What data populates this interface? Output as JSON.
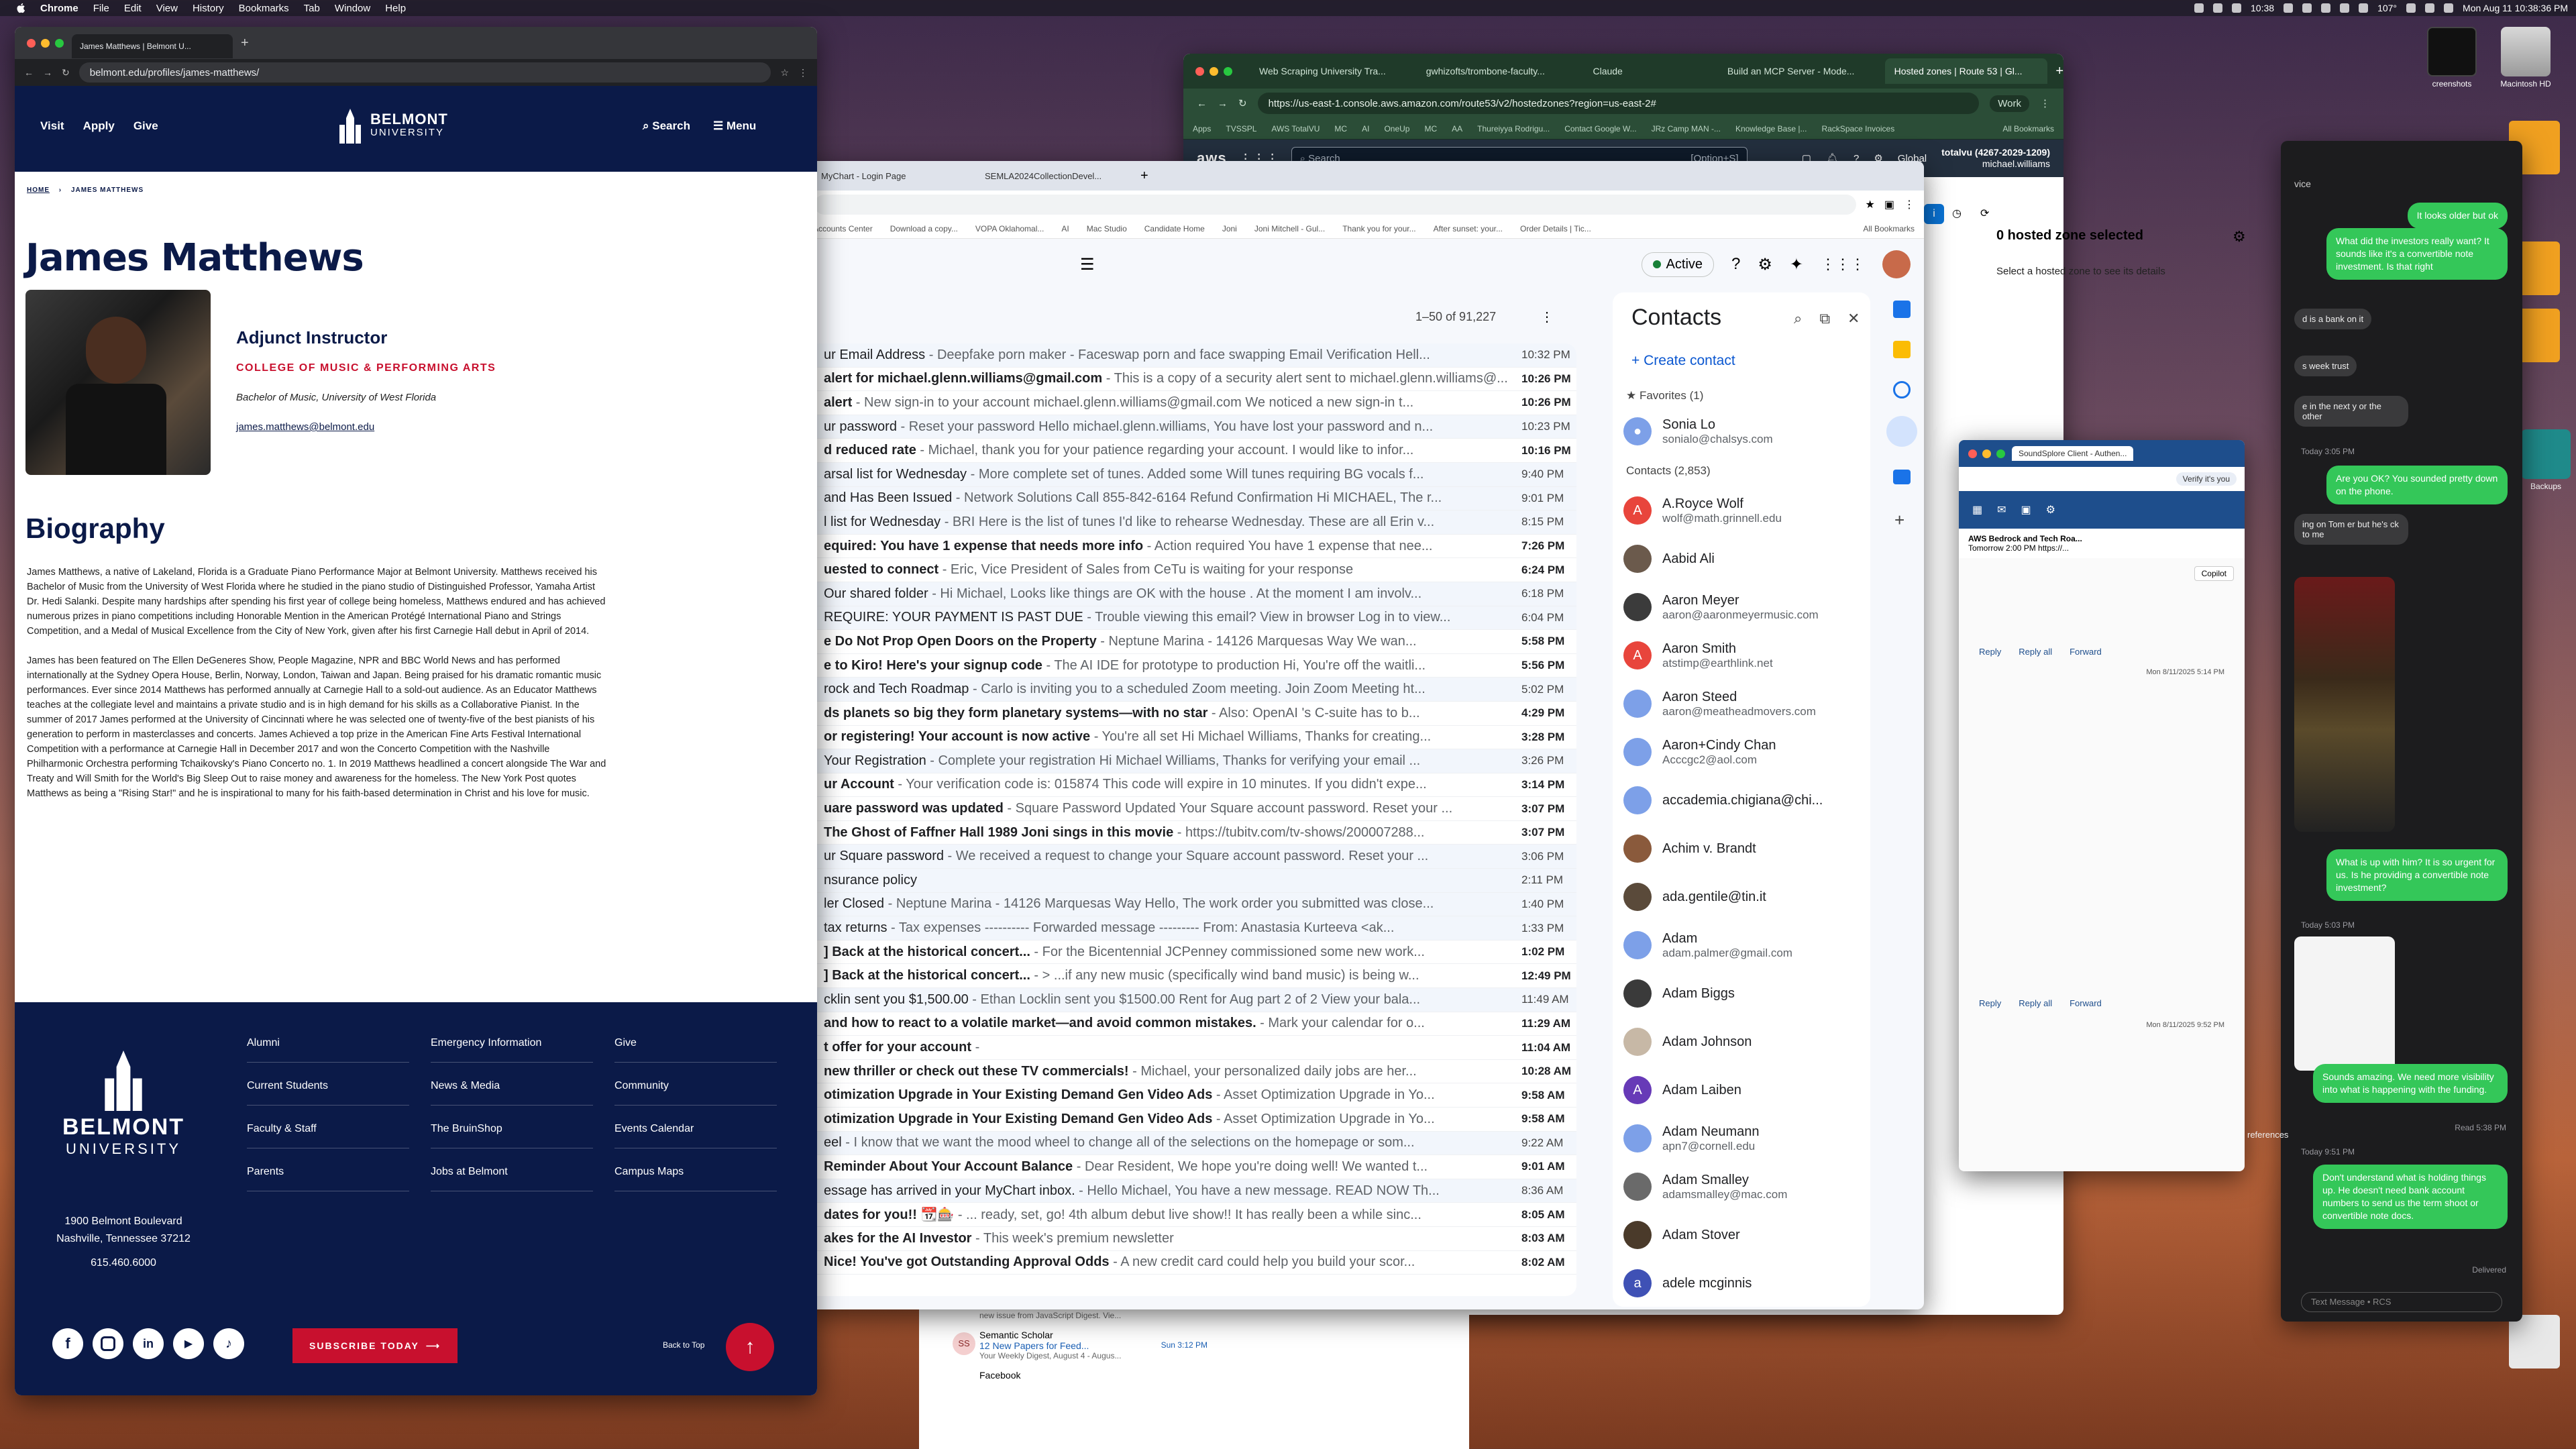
{
  "menubar": {
    "app": "Chrome",
    "items": [
      "File",
      "Edit",
      "View",
      "History",
      "Bookmarks",
      "Tab",
      "Window",
      "Help"
    ],
    "time_small": "10:38",
    "weather": "107°",
    "datetime": "Mon Aug 11  10:38:36 PM"
  },
  "desktop": {
    "icons": [
      "Macintosh HD",
      "creenshots",
      "Backups"
    ]
  },
  "aws": {
    "tabs": [
      "Web Scraping University Tra...",
      "gwhizofts/trombone-faculty...",
      "Claude",
      "Build an MCP Server - Mode...",
      "Hosted zones | Route 53 | Gl..."
    ],
    "url": "https://us-east-1.console.aws.amazon.com/route53/v2/hostedzones?region=us-east-2#",
    "profile": "Work",
    "bookmarks": [
      "Apps",
      "TVSSPL",
      "AWS TotalVU",
      "MC",
      "AI",
      "OneUp",
      "MC",
      "AA",
      "Thureiyya Rodrigu...",
      "Contact Google W...",
      "JRz Camp MAN -...",
      "Knowledge Base |...",
      "RackSpace Invoices",
      "All Bookmarks"
    ],
    "search_placeholder": "Search",
    "search_shortcut": "[Option+S]",
    "region": "Global",
    "account": "totalvu (4267-2029-1209)",
    "user": "michael.williams",
    "panel_title": "0 hosted zone selected",
    "panel_text": "Select a hosted zone to see its details"
  },
  "messages": {
    "items": [
      {
        "type": "out",
        "text": "It looks older but ok"
      },
      {
        "type": "out",
        "text": "What did the investors really want? It sounds like it's a convertible note investment. Is that right"
      },
      {
        "type": "in",
        "text": "d is a bank on it"
      },
      {
        "type": "in",
        "text": "s week trust"
      },
      {
        "type": "in",
        "text": "e in the next y or the other"
      },
      {
        "type": "time",
        "text": "Today 3:05 PM"
      },
      {
        "type": "out",
        "text": "Are you OK? You sounded pretty down on the phone."
      },
      {
        "type": "in",
        "text": "ing on Tom er but he's ck to me"
      },
      {
        "type": "out",
        "text": "What is up with him? It is so urgent for us. Is he providing a convertible note investment?"
      },
      {
        "type": "time",
        "text": "Today 5:03 PM"
      },
      {
        "type": "out",
        "text": "Sounds amazing. We need more visibility into what is happening with the funding."
      },
      {
        "type": "read",
        "text": "Read 5:38 PM"
      },
      {
        "type": "time",
        "text": "Today 9:51 PM"
      },
      {
        "type": "out",
        "text": "Don't understand what is holding things up. He doesn't need bank account numbers to send us the term shoot or convertible note docs."
      },
      {
        "type": "read",
        "text": "Delivered"
      }
    ],
    "input_placeholder": "Text Message • RCS"
  },
  "gmail": {
    "tabs": [
      "MyChart - Login Page",
      "SEMLA2024CollectionDevel..."
    ],
    "bookmarks": [
      "Accounts Center",
      "Download a copy...",
      "VOPA Oklahomal...",
      "AI",
      "Mac Studio",
      "Candidate Home",
      "Joni",
      "Joni Mitchell - Gul...",
      "Thank you for your...",
      "After sunset: your...",
      "Order Details | Tic...",
      "All Bookmarks"
    ],
    "status": "Active",
    "range": "1–50 of 91,227",
    "emails": [
      {
        "subject": "ur Email Address",
        "snippet": " - Deepfake porn maker - Faceswap porn and face swapping Email Verification Hell...",
        "time": "10:32 PM",
        "unread": false
      },
      {
        "subject": "alert for michael.glenn.williams@gmail.com",
        "snippet": " - This is a copy of a security alert sent to michael.glenn.williams@...",
        "time": "10:26 PM",
        "unread": true
      },
      {
        "subject": "alert",
        "snippet": " - New sign-in to your account michael.glenn.williams@gmail.com We noticed a new sign-in t...",
        "time": "10:26 PM",
        "unread": true
      },
      {
        "subject": "ur password",
        "snippet": " - Reset your password Hello michael.glenn.williams, You have lost your password and n...",
        "time": "10:23 PM",
        "unread": false
      },
      {
        "subject": "d reduced rate",
        "snippet": " - Michael, thank you for your patience regarding your account. I would like to infor...",
        "time": "10:16 PM",
        "unread": true
      },
      {
        "subject": "arsal list for Wednesday",
        "snippet": " - More complete set of tunes. Added some Will tunes requiring BG vocals f...",
        "time": "9:40 PM",
        "unread": false
      },
      {
        "subject": "and Has Been Issued",
        "snippet": " - Network Solutions Call 855-842-6164 Refund Confirmation Hi MICHAEL, The r...",
        "time": "9:01 PM",
        "unread": false
      },
      {
        "subject": "l list for Wednesday",
        "snippet": " - BRI Here is the list of tunes I'd like to rehearse Wednesday. These are all Erin v...",
        "time": "8:15 PM",
        "unread": false
      },
      {
        "subject": "equired: You have 1 expense that needs more info",
        "snippet": " - Action required You have 1 expense that nee...",
        "time": "7:26 PM",
        "unread": true
      },
      {
        "subject": "uested to connect",
        "snippet": " - Eric, Vice President of Sales from CeTu is waiting for your response",
        "time": "6:24 PM",
        "unread": true
      },
      {
        "subject": " Our shared folder",
        "snippet": " - Hi Michael, Looks like things are OK with the house . At the moment I am involv...",
        "time": "6:18 PM",
        "unread": false
      },
      {
        "subject": "REQUIRE: YOUR PAYMENT IS PAST DUE",
        "snippet": " - Trouble viewing this email? View in browser Log in to view...",
        "time": "6:04 PM",
        "unread": false
      },
      {
        "subject": "e Do Not Prop Open Doors on the Property",
        "snippet": " - Neptune Marina - 14126 Marquesas Way We wan...",
        "time": "5:58 PM",
        "unread": true
      },
      {
        "subject": "e to Kiro! Here's your signup code",
        "snippet": " - The AI IDE for prototype to production Hi, You're off the waitli...",
        "time": "5:56 PM",
        "unread": true
      },
      {
        "subject": "rock and Tech Roadmap",
        "snippet": " - Carlo is inviting you to a scheduled Zoom meeting. Join Zoom Meeting ht...",
        "time": "5:02 PM",
        "unread": false
      },
      {
        "subject": "ds planets so big they form planetary systems—with no star",
        "snippet": " - Also: OpenAI 's C-suite has to b...",
        "time": "4:29 PM",
        "unread": true
      },
      {
        "subject": "or registering! Your account is now active",
        "snippet": " - You're all set Hi Michael Williams, Thanks for creating...",
        "time": "3:28 PM",
        "unread": true
      },
      {
        "subject": " Your Registration",
        "snippet": " - Complete your registration Hi Michael Williams, Thanks for verifying your email ...",
        "time": "3:26 PM",
        "unread": false
      },
      {
        "subject": "ur Account",
        "snippet": " - Your verification code is: 015874 This code will expire in 10 minutes. If you didn't expe...",
        "time": "3:14 PM",
        "unread": true
      },
      {
        "subject": "uare password was updated",
        "snippet": " - Square Password Updated Your Square account password. Reset your ...",
        "time": "3:07 PM",
        "unread": true
      },
      {
        "subject": "The Ghost of Faffner Hall 1989 Joni sings in this movie",
        "snippet": " - https://tubitv.com/tv-shows/200007288...",
        "time": "3:07 PM",
        "unread": true
      },
      {
        "subject": "ur Square password",
        "snippet": " - We received a request to change your Square account password. Reset your ...",
        "time": "3:06 PM",
        "unread": false
      },
      {
        "subject": "nsurance policy",
        "snippet": "",
        "time": "2:11 PM",
        "unread": false
      },
      {
        "subject": "ler Closed",
        "snippet": " - Neptune Marina - 14126 Marquesas Way Hello, The work order you submitted was close...",
        "time": "1:40 PM",
        "unread": false
      },
      {
        "subject": "tax returns",
        "snippet": " - Tax expenses ---------- Forwarded message --------- From: Anastasia Kurteeva <ak...",
        "time": "1:33 PM",
        "unread": false
      },
      {
        "subject": "] Back at the historical concert...",
        "snippet": " - For the Bicentennial JCPenney commissioned some new work...",
        "time": "1:02 PM",
        "unread": true
      },
      {
        "subject": "] Back at the historical concert...",
        "snippet": " - > ...if any new music (specifically wind band music) is being w...",
        "time": "12:49 PM",
        "unread": true
      },
      {
        "subject": "cklin sent you $1,500.00",
        "snippet": " - Ethan Locklin sent you $1500.00 Rent for Aug part 2 of 2 View your bala...",
        "time": "11:49 AM",
        "unread": false
      },
      {
        "subject": "and how to react to a volatile market—and avoid common mistakes.",
        "snippet": " - Mark your calendar for o...",
        "time": "11:29 AM",
        "unread": true
      },
      {
        "subject": "t offer for your account",
        "snippet": " -",
        "time": "11:04 AM",
        "unread": true
      },
      {
        "subject": "new thriller or check out these TV commercials!",
        "snippet": " - Michael, your personalized daily jobs are her...",
        "time": "10:28 AM",
        "unread": true
      },
      {
        "subject": "otimization Upgrade in Your Existing Demand Gen Video Ads",
        "snippet": " - Asset Optimization Upgrade in Yo...",
        "time": "9:58 AM",
        "unread": true
      },
      {
        "subject": "otimization Upgrade in Your Existing Demand Gen Video Ads",
        "snippet": " - Asset Optimization Upgrade in Yo...",
        "time": "9:58 AM",
        "unread": true
      },
      {
        "subject": "eel",
        "snippet": " - I know that we want the mood wheel to change all of the selections on the homepage or som...",
        "time": "9:22 AM",
        "unread": false
      },
      {
        "subject": "Reminder About Your Account Balance",
        "snippet": " - Dear Resident, We hope you're doing well! We wanted t...",
        "time": "9:01 AM",
        "unread": true
      },
      {
        "subject": "essage has arrived in your MyChart inbox.",
        "snippet": " - Hello Michael, You have a new message. READ NOW Th...",
        "time": "8:36 AM",
        "unread": false
      },
      {
        "subject": " dates for you!! 📆🎰",
        "snippet": " - ... ready, set, go! 4th album debut live show!! It has really been a while sinc...",
        "time": "8:05 AM",
        "unread": true
      },
      {
        "subject": "akes for the AI Investor",
        "snippet": " - This week's premium newsletter",
        "time": "8:03 AM",
        "unread": true
      },
      {
        "subject": " Nice! You've got Outstanding Approval Odds",
        "snippet": " - A new credit card could help you build your scor...",
        "time": "8:02 AM",
        "unread": true
      }
    ]
  },
  "contacts": {
    "title": "Contacts",
    "create": "Create contact",
    "favorites_label": "Favorites (1)",
    "contacts_label": "Contacts (2,853)",
    "favorites": [
      {
        "name": "Sonia Lo",
        "email": "sonialo@chalsys.com",
        "initial": ""
      }
    ],
    "list": [
      {
        "name": "A.Royce Wolf",
        "email": "wolf@math.grinnell.edu",
        "initial": "A",
        "color": "#e8453c"
      },
      {
        "name": "Aabid Ali",
        "email": "",
        "initial": "",
        "color": "#6b5a4c"
      },
      {
        "name": "Aaron Meyer",
        "email": "aaron@aaronmeyermusic.com",
        "initial": "",
        "color": "#3b3b3b"
      },
      {
        "name": "Aaron Smith",
        "email": "atstimp@earthlink.net",
        "initial": "A",
        "color": "#e8453c"
      },
      {
        "name": "Aaron Steed",
        "email": "aaron@meatheadmovers.com",
        "initial": "",
        "color": "#7da0e8"
      },
      {
        "name": "Aaron+Cindy Chan",
        "email": "Acccgc2@aol.com",
        "initial": "",
        "color": "#7da0e8"
      },
      {
        "name": "accademia.chigiana@chi...",
        "email": "",
        "initial": "",
        "color": "#7da0e8"
      },
      {
        "name": "Achim v. Brandt",
        "email": "",
        "initial": "",
        "color": "#8a5a3c"
      },
      {
        "name": "ada.gentile@tin.it",
        "email": "",
        "initial": "",
        "color": "#5a4a3a"
      },
      {
        "name": "Adam",
        "email": "adam.palmer@gmail.com",
        "initial": "",
        "color": "#7da0e8"
      },
      {
        "name": "Adam Biggs",
        "email": "",
        "initial": "",
        "color": "#3a3a3a"
      },
      {
        "name": "Adam Johnson",
        "email": "",
        "initial": "",
        "color": "#c7b8a6"
      },
      {
        "name": "Adam Laiben",
        "email": "",
        "initial": "A",
        "color": "#673ab7"
      },
      {
        "name": "Adam Neumann",
        "email": "apn7@cornell.edu",
        "initial": "",
        "color": "#7da0e8"
      },
      {
        "name": "Adam Smalley",
        "email": "adamsmalley@mac.com",
        "initial": "",
        "color": "#6a6a6a"
      },
      {
        "name": "Adam Stover",
        "email": "",
        "initial": "",
        "color": "#4a3a2a"
      },
      {
        "name": "adele mcginnis",
        "email": "",
        "initial": "a",
        "color": "#3f51b5"
      }
    ]
  },
  "outlook": {
    "tab": "SoundSplore Client - Authen...",
    "verify": "Verify it's you",
    "event_title": "AWS Bedrock and Tech Roa...",
    "event_time": "Tomorrow 2:00 PM https://...",
    "copilot": "Copilot",
    "reply": "Reply",
    "reply_all": "Reply all",
    "forward": "Forward",
    "date1": "Mon 8/11/2025 5:14 PM",
    "date2": "Mon 8/11/2025 9:52 PM",
    "preferences": "references"
  },
  "semantic": {
    "sender": "Semantic Scholar",
    "title": "12 New Papers for Feed...",
    "time": "Sun 3:12 PM",
    "snippet": "Your Weekly Digest, August 4 - Augus...",
    "next": "Facebook",
    "next_prev": "new issue from JavaScript Digest. Vie..."
  },
  "belmont": {
    "tab_title": "James Matthews | Belmont U...",
    "url": "belmont.edu/profiles/james-matthews/",
    "nav": {
      "visit": "Visit",
      "apply": "Apply",
      "give": "Give",
      "logo_line1": "BELMONT",
      "logo_line2": "UNIVERSITY",
      "search": "Search",
      "menu": "Menu"
    },
    "breadcrumb": {
      "home": "HOME",
      "current": "JAMES MATTHEWS"
    },
    "name": "James Matthews",
    "title": "Adjunct Instructor",
    "college": "COLLEGE OF MUSIC & PERFORMING ARTS",
    "degree": "Bachelor of Music, University of West Florida",
    "email": "james.matthews@belmont.edu",
    "bio_heading": "Biography",
    "bio1": "James Matthews, a native of Lakeland, Florida is a Graduate Piano Performance Major at Belmont University. Matthews received his Bachelor of Music from the University of West Florida where he studied in the piano studio of Distinguished Professor, Yamaha Artist Dr. Hedi Salanki. Despite many hardships after spending his first year of college being homeless, Matthews endured and has achieved numerous prizes in piano competitions including Honorable Mention in the American Protégé International Piano and Strings Competition, and a Medal of Musical Excellence from the City of New York, given after his first Carnegie Hall debut in April of 2014.",
    "bio2": "James has been featured on The Ellen DeGeneres Show, People Magazine, NPR and BBC World News and has performed internationally at the Sydney Opera House, Berlin, Norway, London, Taiwan and Japan. Being praised for his dramatic romantic music performances. Ever since 2014 Matthews has performed annually at Carnegie Hall to a sold-out audience. As an Educator Matthews teaches at the collegiate level and maintains a private studio and is in high demand for his skills as a Collaborative Pianist. In the summer of 2017 James performed at the University of Cincinnati where he was selected one of twenty-five of the best pianists of his generation to perform in masterclasses and concerts. James Achieved a top prize in the American Fine Arts Festival International Competition with a performance at Carnegie Hall in December 2017 and won the Concerto Competition with the Nashville Philharmonic Orchestra performing Tchaikovsky's Piano Concerto no. 1. In 2019 Matthews headlined a concert alongside The War and Treaty and Will Smith for the World's Big Sleep Out to raise money and awareness for the homeless. The New York Post quotes Matthews as being a \"Rising Star!\" and he is inspirational to many for his faith-based determination in Christ and his love for music.",
    "footer": {
      "logo_line1": "BELMONT",
      "logo_line2": "UNIVERSITY",
      "address1": "1900 Belmont Boulevard",
      "address2": "Nashville, Tennessee 37212",
      "phone": "615.460.6000",
      "col1": [
        "Alumni",
        "Current Students",
        "Faculty & Staff",
        "Parents"
      ],
      "col2": [
        "Emergency Information",
        "News & Media",
        "The BruinShop",
        "Jobs at Belmont"
      ],
      "col3": [
        "Give",
        "Community",
        "Events Calendar",
        "Campus Maps"
      ],
      "subscribe": "SUBSCRIBE TODAY",
      "back_to_top": "Back to Top"
    }
  },
  "colors": {
    "belmont_navy": "#0b1a48",
    "belmont_red": "#c8102e",
    "gmail_blue": "#1a73e8",
    "imessage_green": "#34c759"
  }
}
